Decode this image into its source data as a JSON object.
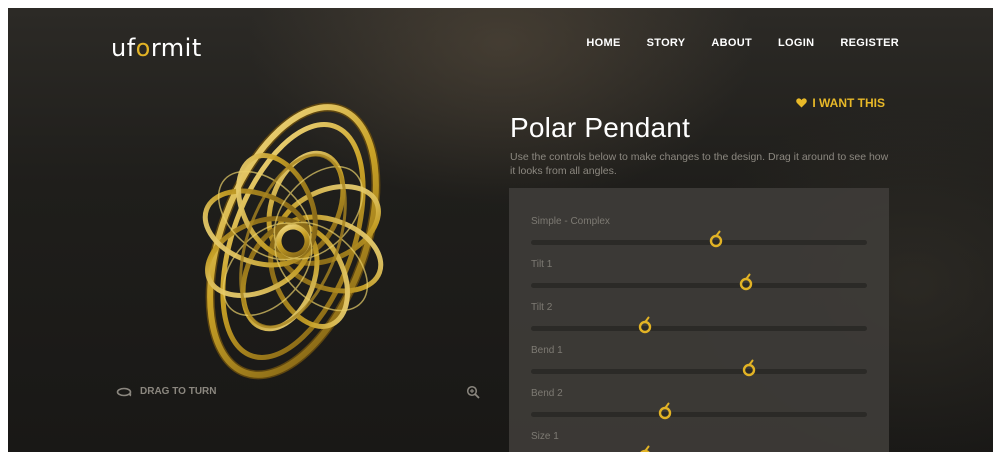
{
  "header": {
    "logo": {
      "prefix": "uf",
      "accent": "o",
      "suffix": "rmit"
    },
    "nav": [
      {
        "label": "HOME"
      },
      {
        "label": "STORY"
      },
      {
        "label": "ABOUT"
      },
      {
        "label": "LOGIN"
      },
      {
        "label": "REGISTER"
      }
    ]
  },
  "viewer": {
    "drag_label": "DRAG TO TURN",
    "drag_icon": "rotate-icon",
    "zoom_icon": "zoom-in-icon"
  },
  "product": {
    "want_label": "I WANT THIS",
    "want_icon": "heart-icon",
    "title": "Polar Pendant",
    "description": "Use the controls below to make changes to the design. Drag it around to see how it looks from all angles."
  },
  "controls": [
    {
      "label": "Simple - Complex",
      "value": 0.55
    },
    {
      "label": "Tilt 1",
      "value": 0.64
    },
    {
      "label": "Tilt 2",
      "value": 0.34
    },
    {
      "label": "Bend 1",
      "value": 0.65
    },
    {
      "label": "Bend 2",
      "value": 0.4
    },
    {
      "label": "Size 1",
      "value": 0.34
    }
  ],
  "colors": {
    "accent": "#e2b325",
    "background": "#1f1e1b",
    "panel": "#3e3c38",
    "gold": "#c9a227"
  }
}
